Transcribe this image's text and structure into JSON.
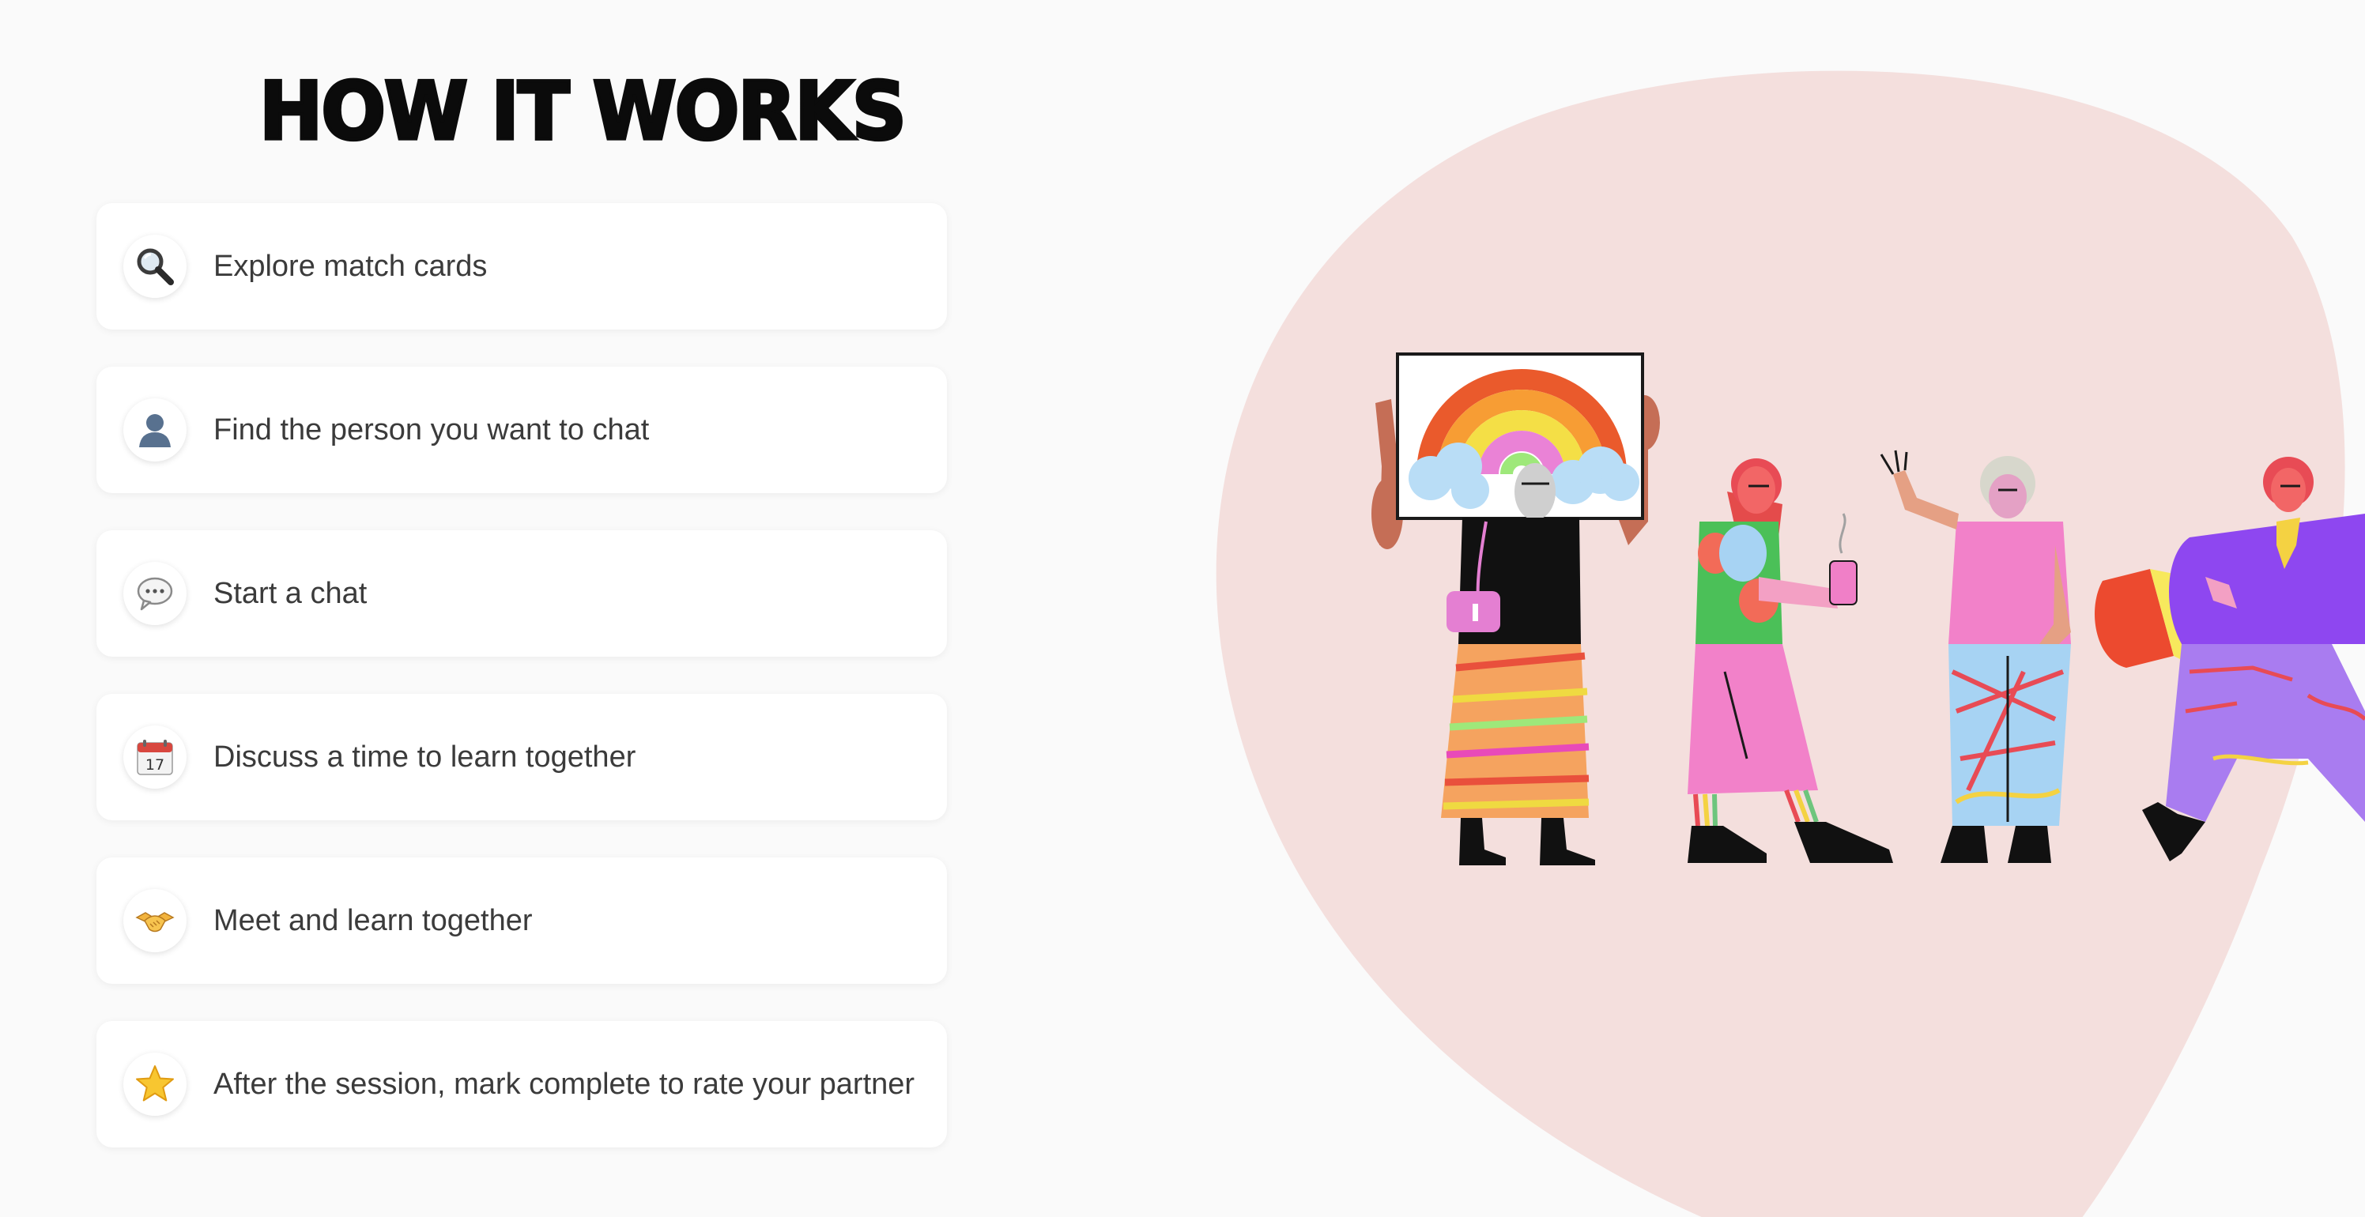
{
  "section": {
    "title": "HOW IT WORKS"
  },
  "steps": [
    {
      "icon": "magnifying-glass-icon",
      "label": "Explore match cards"
    },
    {
      "icon": "person-silhouette-icon",
      "label": "Find the person you want to chat"
    },
    {
      "icon": "speech-bubble-icon",
      "label": "Start a chat"
    },
    {
      "icon": "calendar-icon",
      "label": "Discuss a time to learn together",
      "calendar_day": "17"
    },
    {
      "icon": "handshake-icon",
      "label": "Meet and learn together"
    },
    {
      "icon": "star-icon",
      "label": "After the session, mark complete to rate your partner"
    }
  ],
  "colors": {
    "background": "#fafafa",
    "blob": "#f4dfdd",
    "card": "#ffffff",
    "title": "#0b0b0b",
    "text": "#3b3b3b"
  },
  "illustration": {
    "icon": "people-marching-with-rainbow-sign-illustration"
  }
}
